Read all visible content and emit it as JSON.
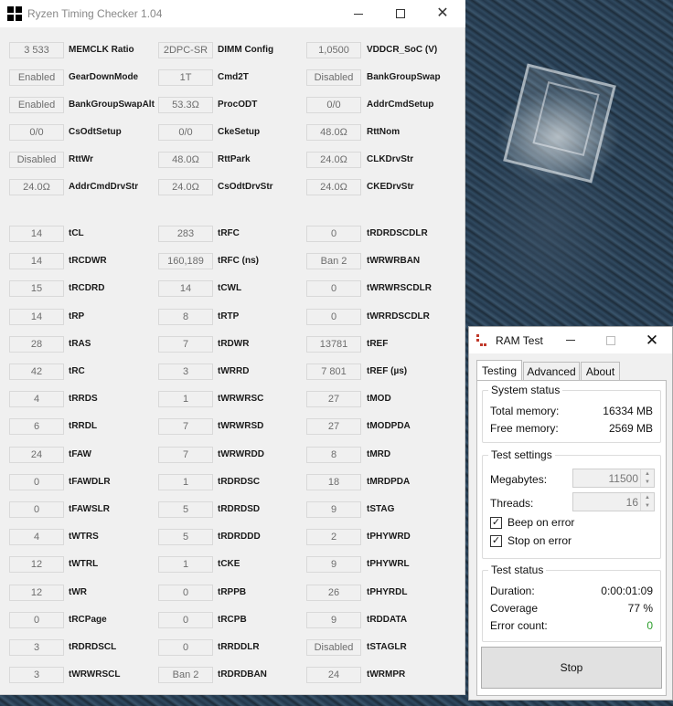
{
  "main_window": {
    "title": "Ryzen Timing Checker 1.04",
    "top_rows": [
      [
        [
          "3 533",
          "MEMCLK Ratio"
        ],
        [
          "2DPC-SR",
          "DIMM Config"
        ],
        [
          "1,0500",
          "VDDCR_SoC (V)"
        ]
      ],
      [
        [
          "Enabled",
          "GearDownMode"
        ],
        [
          "1T",
          "Cmd2T"
        ],
        [
          "Disabled",
          "BankGroupSwap"
        ]
      ],
      [
        [
          "Enabled",
          "BankGroupSwapAlt"
        ],
        [
          "53.3Ω",
          "ProcODT"
        ],
        [
          "0/0",
          "AddrCmdSetup"
        ]
      ],
      [
        [
          "0/0",
          "CsOdtSetup"
        ],
        [
          "0/0",
          "CkeSetup"
        ],
        [
          "48.0Ω",
          "RttNom"
        ]
      ],
      [
        [
          "Disabled",
          "RttWr"
        ],
        [
          "48.0Ω",
          "RttPark"
        ],
        [
          "24.0Ω",
          "CLKDrvStr"
        ]
      ],
      [
        [
          "24.0Ω",
          "AddrCmdDrvStr"
        ],
        [
          "24.0Ω",
          "CsOdtDrvStr"
        ],
        [
          "24.0Ω",
          "CKEDrvStr"
        ]
      ]
    ],
    "timing_rows": [
      [
        [
          "14",
          "tCL"
        ],
        [
          "283",
          "tRFC"
        ],
        [
          "0",
          "tRDRDSCDLR"
        ]
      ],
      [
        [
          "14",
          "tRCDWR"
        ],
        [
          "160,189",
          "tRFC (ns)"
        ],
        [
          "Ban 2",
          "tWRWRBAN"
        ]
      ],
      [
        [
          "15",
          "tRCDRD"
        ],
        [
          "14",
          "tCWL"
        ],
        [
          "0",
          "tWRWRSCDLR"
        ]
      ],
      [
        [
          "14",
          "tRP"
        ],
        [
          "8",
          "tRTP"
        ],
        [
          "0",
          "tWRRDSCDLR"
        ]
      ],
      [
        [
          "28",
          "tRAS"
        ],
        [
          "7",
          "tRDWR"
        ],
        [
          "13781",
          "tREF"
        ]
      ],
      [
        [
          "42",
          "tRC"
        ],
        [
          "3",
          "tWRRD"
        ],
        [
          "7 801",
          "tREF (µs)"
        ]
      ],
      [
        [
          "4",
          "tRRDS"
        ],
        [
          "1",
          "tWRWRSC"
        ],
        [
          "27",
          "tMOD"
        ]
      ],
      [
        [
          "6",
          "tRRDL"
        ],
        [
          "7",
          "tWRWRSD"
        ],
        [
          "27",
          "tMODPDA"
        ]
      ],
      [
        [
          "24",
          "tFAW"
        ],
        [
          "7",
          "tWRWRDD"
        ],
        [
          "8",
          "tMRD"
        ]
      ],
      [
        [
          "0",
          "tFAWDLR"
        ],
        [
          "1",
          "tRDRDSC"
        ],
        [
          "18",
          "tMRDPDA"
        ]
      ],
      [
        [
          "0",
          "tFAWSLR"
        ],
        [
          "5",
          "tRDRDSD"
        ],
        [
          "9",
          "tSTAG"
        ]
      ],
      [
        [
          "4",
          "tWTRS"
        ],
        [
          "5",
          "tRDRDDD"
        ],
        [
          "2",
          "tPHYWRD"
        ]
      ],
      [
        [
          "12",
          "tWTRL"
        ],
        [
          "1",
          "tCKE"
        ],
        [
          "9",
          "tPHYWRL"
        ]
      ],
      [
        [
          "12",
          "tWR"
        ],
        [
          "0",
          "tRPPB"
        ],
        [
          "26",
          "tPHYRDL"
        ]
      ],
      [
        [
          "0",
          "tRCPage"
        ],
        [
          "0",
          "tRCPB"
        ],
        [
          "9",
          "tRDDATA"
        ]
      ],
      [
        [
          "3",
          "tRDRDSCL"
        ],
        [
          "0",
          "tRRDDLR"
        ],
        [
          "Disabled",
          "tSTAGLR"
        ]
      ],
      [
        [
          "3",
          "tWRWRSCL"
        ],
        [
          "Ban 2",
          "tRDRDBAN"
        ],
        [
          "24",
          "tWRMPR"
        ]
      ]
    ]
  },
  "ram_test": {
    "title": "RAM Test",
    "tabs": [
      "Testing",
      "Advanced",
      "About"
    ],
    "active_tab": "Testing",
    "system_status": {
      "title": "System status",
      "total_label": "Total memory:",
      "total_value": "16334 MB",
      "free_label": "Free memory:",
      "free_value": "2569 MB"
    },
    "test_settings": {
      "title": "Test settings",
      "megabytes_label": "Megabytes:",
      "megabytes_value": "11500",
      "threads_label": "Threads:",
      "threads_value": "16",
      "beep_label": "Beep on error",
      "beep_checked": true,
      "stop_label": "Stop on error",
      "stop_checked": true
    },
    "test_status": {
      "title": "Test status",
      "duration_label": "Duration:",
      "duration_value": "0:00:01:09",
      "coverage_label": "Coverage",
      "coverage_value": "77 %",
      "errors_label": "Error count:",
      "errors_value": "0"
    },
    "stop_button": "Stop"
  },
  "colors": {
    "error_count": "#2a9d2a",
    "window_bg": "#f0f0f0"
  }
}
